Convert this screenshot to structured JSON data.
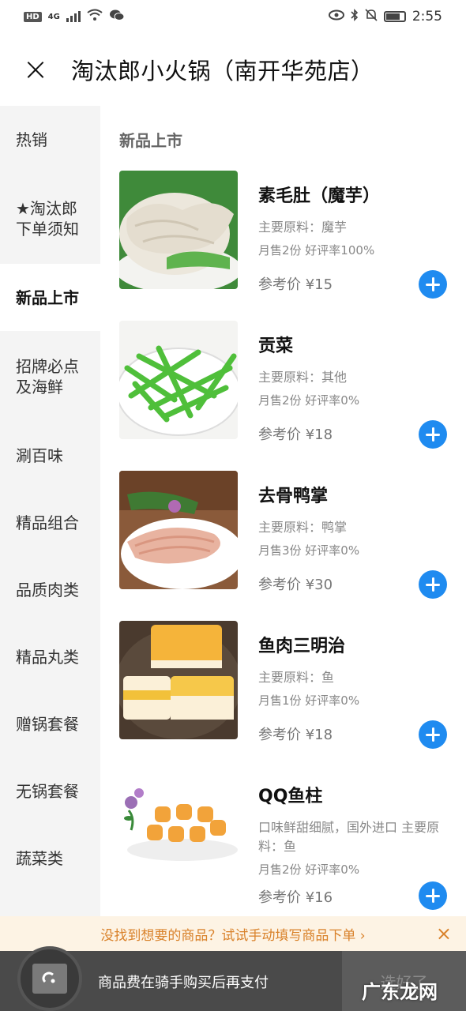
{
  "status_bar": {
    "left_chip": "HD",
    "network": "4G",
    "time": "2:55"
  },
  "header": {
    "close_label": "×",
    "store_name": "淘汰郎小火锅（南开华苑店）"
  },
  "sidebar": {
    "items": [
      {
        "label": "热销"
      },
      {
        "label": "★淘汰郎\n下单须知"
      },
      {
        "label": "新品上市"
      },
      {
        "label": "招牌必点\n及海鲜"
      },
      {
        "label": "涮百味"
      },
      {
        "label": "精品组合"
      },
      {
        "label": "品质肉类"
      },
      {
        "label": "精品丸类"
      },
      {
        "label": "赠锅套餐"
      },
      {
        "label": "无锅套餐"
      },
      {
        "label": "蔬菜类"
      }
    ],
    "active_index": 2
  },
  "main": {
    "section_title": "新品上市",
    "items": [
      {
        "name": "素毛肚（魔芋）",
        "material": "主要原料：魔芋",
        "sales": "月售2份 好评率100%",
        "price": "参考价 ¥15",
        "image": "tripe-image"
      },
      {
        "name": "贡菜",
        "material": "主要原料：其他",
        "sales": "月售2份 好评率0%",
        "price": "参考价 ¥18",
        "image": "gongcai-image"
      },
      {
        "name": "去骨鸭掌",
        "material": "主要原料：鸭掌",
        "sales": "月售3份 好评率0%",
        "price": "参考价 ¥30",
        "image": "duck-feet-image"
      },
      {
        "name": "鱼肉三明治",
        "material": "主要原料：鱼",
        "sales": "月售1份 好评率0%",
        "price": "参考价 ¥18",
        "image": "fish-sandwich-image"
      },
      {
        "name": "QQ鱼柱",
        "material": "口味鲜甜细腻，国外进口 主要原料：鱼",
        "sales": "月售2份 好评率0%",
        "price": "参考价 ¥16",
        "image": "fish-column-image"
      }
    ]
  },
  "banner": {
    "text": "没找到想要的商品？试试手动填写商品下单 ›",
    "close": "×"
  },
  "bottom_bar": {
    "pay_note": "商品费在骑手购买后再支付",
    "checkout_label": "选好了",
    "watermark": "广东龙网"
  },
  "colors": {
    "accent_blue": "#1f8bf0",
    "banner_text": "#d9822b",
    "banner_bg": "#fdf3e4"
  }
}
